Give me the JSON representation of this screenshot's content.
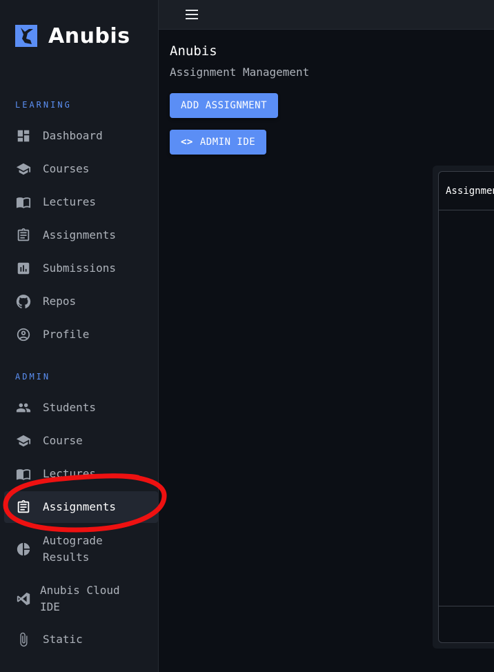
{
  "brand": {
    "name": "Anubis",
    "accent": "#5b8ef5"
  },
  "sidebar": {
    "sections": [
      {
        "label": "LEARNING"
      },
      {
        "label": "ADMIN"
      }
    ],
    "learning_items": [
      {
        "label": "Dashboard",
        "icon": "dashboard-icon"
      },
      {
        "label": "Courses",
        "icon": "school-icon"
      },
      {
        "label": "Lectures",
        "icon": "book-icon"
      },
      {
        "label": "Assignments",
        "icon": "assignment-icon"
      },
      {
        "label": "Submissions",
        "icon": "bar-chart-icon"
      },
      {
        "label": "Repos",
        "icon": "github-icon"
      },
      {
        "label": "Profile",
        "icon": "account-circle-icon"
      }
    ],
    "admin_items": [
      {
        "label": "Students",
        "icon": "people-icon"
      },
      {
        "label": "Course",
        "icon": "school-icon"
      },
      {
        "label": "Lectures",
        "icon": "book-icon"
      },
      {
        "label": "Assignments",
        "icon": "assignment-icon",
        "active": true
      },
      {
        "label": "Autograde Results",
        "icon": "pie-chart-icon"
      },
      {
        "label": "Anubis Cloud IDE",
        "icon": "vscode-icon"
      },
      {
        "label": "Static",
        "icon": "attach-icon"
      }
    ]
  },
  "main": {
    "title": "Anubis",
    "subtitle": "Assignment Management",
    "add_button": "ADD ASSIGNMENT",
    "ide_button": "ADMIN IDE",
    "table_header": "Assignment"
  }
}
